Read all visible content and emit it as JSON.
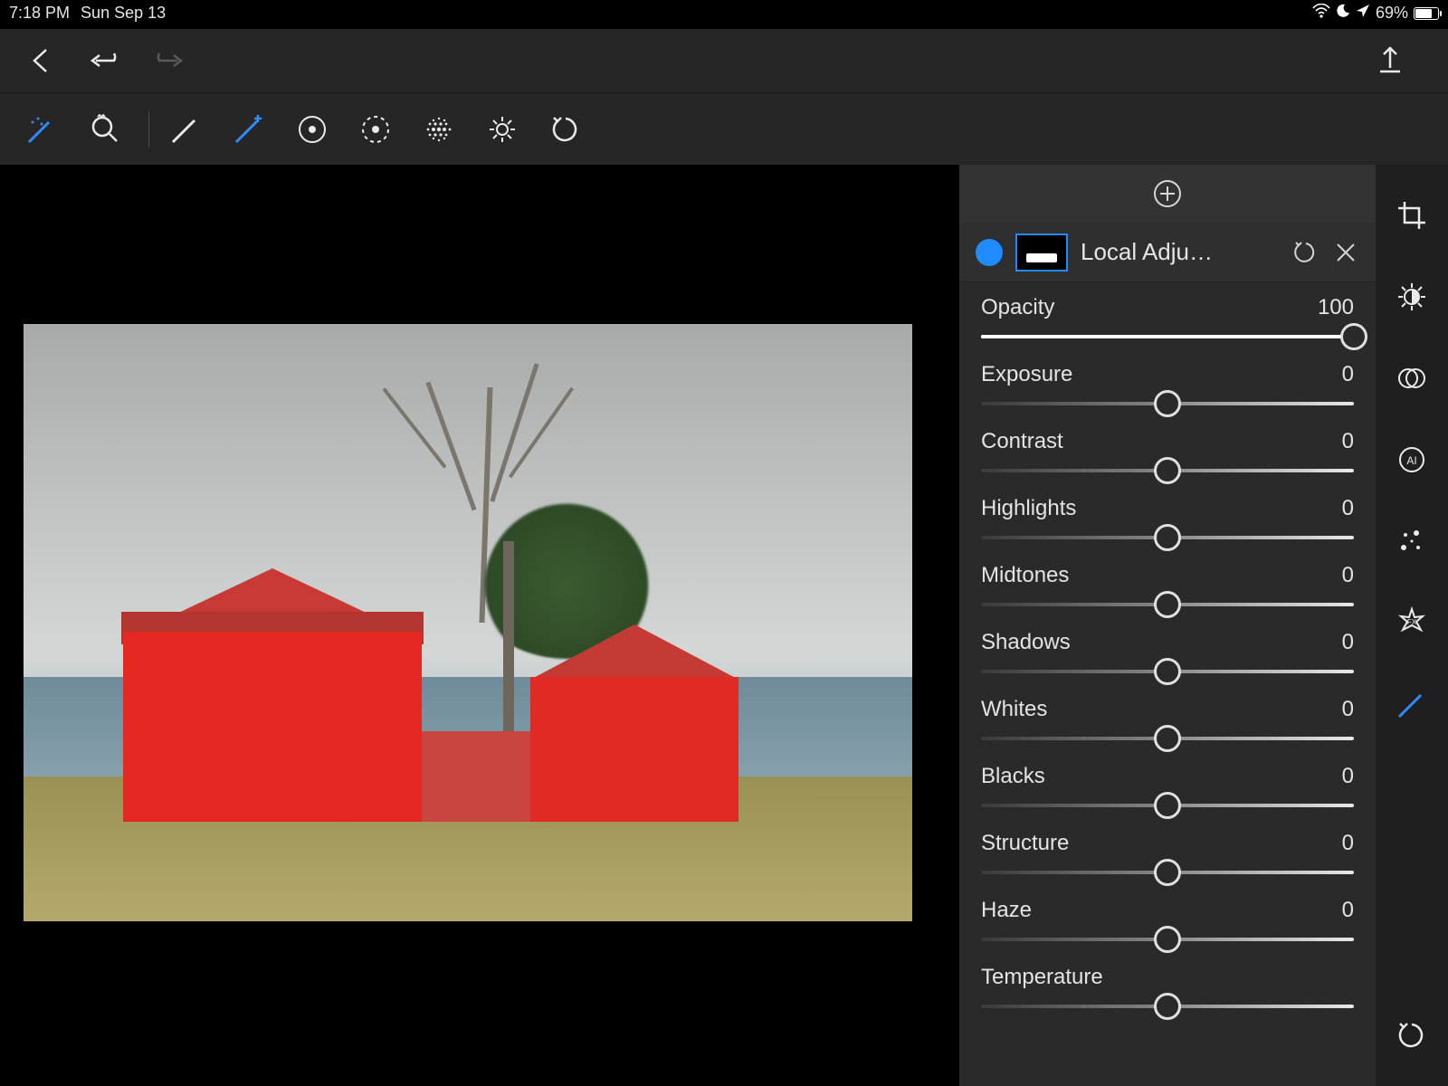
{
  "status": {
    "time": "7:18 PM",
    "date": "Sun Sep 13",
    "battery": "69%"
  },
  "panel": {
    "title": "Local Adju…",
    "sliders": [
      {
        "label": "Opacity",
        "value": "100",
        "pos": 100,
        "bipolar": false
      },
      {
        "label": "Exposure",
        "value": "0",
        "pos": 50,
        "bipolar": true
      },
      {
        "label": "Contrast",
        "value": "0",
        "pos": 50,
        "bipolar": true
      },
      {
        "label": "Highlights",
        "value": "0",
        "pos": 50,
        "bipolar": true
      },
      {
        "label": "Midtones",
        "value": "0",
        "pos": 50,
        "bipolar": true
      },
      {
        "label": "Shadows",
        "value": "0",
        "pos": 50,
        "bipolar": true
      },
      {
        "label": "Whites",
        "value": "0",
        "pos": 50,
        "bipolar": true
      },
      {
        "label": "Blacks",
        "value": "0",
        "pos": 50,
        "bipolar": true
      },
      {
        "label": "Structure",
        "value": "0",
        "pos": 50,
        "bipolar": true
      },
      {
        "label": "Haze",
        "value": "0",
        "pos": 50,
        "bipolar": true
      },
      {
        "label": "Temperature",
        "value": "",
        "pos": 50,
        "bipolar": true
      }
    ]
  }
}
